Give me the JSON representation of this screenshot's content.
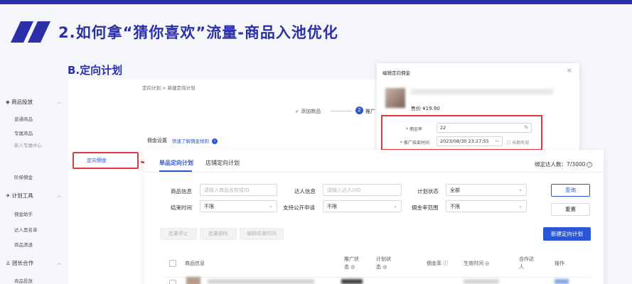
{
  "slide": {
    "title": "2.如何拿“猜你喜欢”流量-商品入池优化",
    "section": "B.定向计划",
    "colors": {
      "brand": "#2b2fa8",
      "highlight": "#e03a3a",
      "primary": "#2b57d6"
    }
  },
  "sidebar": {
    "groups": [
      {
        "label": "商品投放",
        "icon": "shield-icon"
      },
      {
        "label": "计划工具",
        "icon": "rocket-icon"
      },
      {
        "label": "团长合作",
        "icon": "users-icon"
      }
    ],
    "items": [
      "普通商品",
      "专属商品",
      "新人专属中心",
      "定向佣金",
      "阶梯佣金",
      "佣金助手",
      "达人黑名单",
      "商品清退",
      "商品投放"
    ]
  },
  "background_page": {
    "breadcrumb": "定向计划 > 新建定向计划",
    "step1": "添加商品",
    "step2_num": "2",
    "step2": "推广",
    "commission_setting": "佣金设置",
    "commission_link": "快速了解佣金规则"
  },
  "dialog": {
    "title": "编辑定向佣金",
    "close": "×",
    "price": "售价 ¥19.90",
    "rate_label": "* 佣金率",
    "rate_value": "22",
    "rate_suffix": "%",
    "end_label": "* 推广结束时间",
    "end_value": "2023/08/30 23:27:55",
    "long_term": "长期有效"
  },
  "panel": {
    "tabs": [
      "单品定向计划",
      "店铺定向计划"
    ],
    "talent_count": "绑定达人数：7/3000",
    "filters": {
      "product_label": "商品信息",
      "product_placeholder": "请输入商品名称或ID",
      "talent_label": "达人信息",
      "talent_placeholder": "请输入达人UID",
      "status_label": "计划状态",
      "status_value": "全部",
      "end_label": "结束时间",
      "end_value": "不限",
      "public_label": "支持公开申请",
      "public_value": "不限",
      "rate_label": "佣金率范围",
      "rate_value": "不限"
    },
    "buttons": {
      "query": "查询",
      "reset": "重置",
      "batch_stop": "批量停止",
      "batch_delete": "批量删除",
      "edit_end": "编辑结束时间",
      "new_plan": "新建定向计划"
    },
    "table_headers": [
      "商品信息",
      "推广状态",
      "计划状态",
      "佣金率",
      "生效时间",
      "合作达人",
      "操作"
    ]
  }
}
